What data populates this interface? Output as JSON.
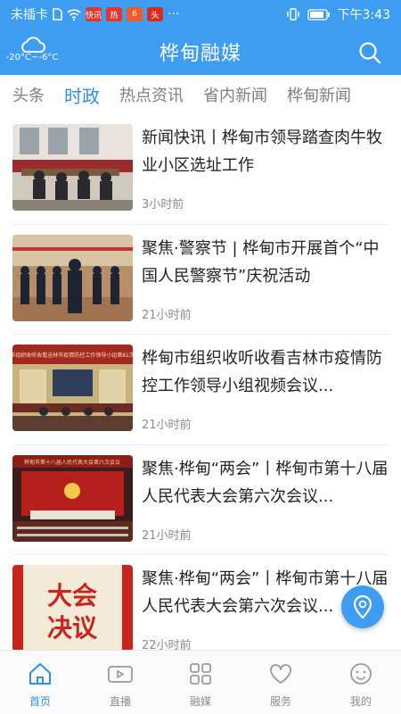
{
  "status_bar": {
    "carrier": "未插卡",
    "time": "下午3:43",
    "app_badges": [
      "快讯",
      "热",
      "6",
      "头"
    ]
  },
  "header": {
    "title": "桦甸融媒",
    "weather_temp": "-20°C~-6°C",
    "weather_icon": "cloud-icon",
    "search_icon": "search-icon"
  },
  "tabs": [
    {
      "label": "头条",
      "active": false
    },
    {
      "label": "时政",
      "active": true
    },
    {
      "label": "热点资讯",
      "active": false
    },
    {
      "label": "省内新闻",
      "active": false
    },
    {
      "label": "桦甸新闻",
      "active": false
    }
  ],
  "news": [
    {
      "headline": "新闻快讯丨桦甸市领导踏查肉牛牧业小区选址工作",
      "time": "3小时前"
    },
    {
      "headline": "聚焦·警察节 | 桦甸市开展首个“中国人民警察节”庆祝活动",
      "time": "21小时前"
    },
    {
      "headline": "桦甸市组织收听收看吉林市疫情防控工作领导小组视频会议...",
      "time": "21小时前"
    },
    {
      "headline": "聚焦·桦甸“两会”丨桦甸市第十八届人民代表大会第六次会议...",
      "time": "21小时前"
    },
    {
      "headline": "聚焦·桦甸“两会”丨桦甸市第十八届人民代表大会第六次会议...",
      "time": "22小时前"
    }
  ],
  "thumb_text": {
    "banner_3": "桦甸市组织收听收看吉林市疫情防控工作领导小组第81次会议",
    "banner_4": "桦甸市第十八届人民代表大会第六次会议",
    "poster_5_line1": "大会",
    "poster_5_line2": "决议"
  },
  "bottom_nav": [
    {
      "label": "首页",
      "icon": "home-icon",
      "active": true
    },
    {
      "label": "直播",
      "icon": "video-camera-icon",
      "active": false
    },
    {
      "label": "融媒",
      "icon": "grid-icon",
      "active": false
    },
    {
      "label": "服务",
      "icon": "heart-icon",
      "active": false
    },
    {
      "label": "我的",
      "icon": "smiley-icon",
      "active": false
    }
  ],
  "colors": {
    "brand": "#3d9df2",
    "active_tab": "#2f90e8",
    "text": "#222222",
    "muted": "#8c8c8c"
  }
}
